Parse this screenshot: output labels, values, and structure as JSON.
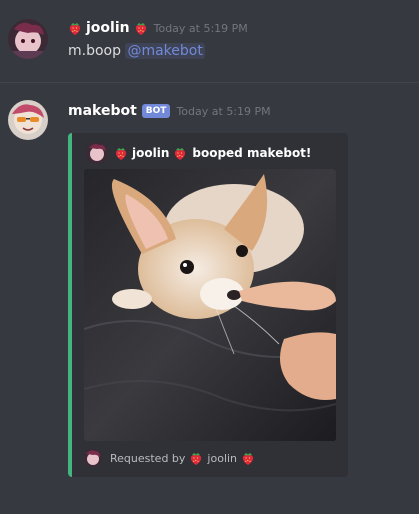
{
  "messages": [
    {
      "author": "joolin",
      "timestamp": "Today at 5:19 PM",
      "text_prefix": "m.boop ",
      "mention": "@makebot"
    },
    {
      "author": "makebot",
      "bot_tag": "BOT",
      "timestamp": "Today at 5:19 PM",
      "embed": {
        "accent_color": "#43b581",
        "author_name": "joolin",
        "author_action": "booped makebot!",
        "image_alt": "corgi puppy being booped on the nose",
        "footer_prefix": "Requested by",
        "footer_name": "joolin"
      }
    }
  ],
  "icons": {
    "strawberry": "strawberry-icon"
  },
  "colors": {
    "background": "#36393f",
    "embed_bg": "#2f3136",
    "mention": "#7289da",
    "bot_tag": "#7289da"
  }
}
